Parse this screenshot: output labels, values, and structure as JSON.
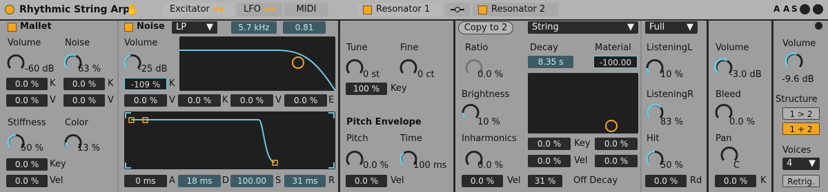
{
  "title_bar": {
    "device_name": "Rhythmic String Arp",
    "tabs": [
      {
        "label": "Excitator",
        "dots": 2
      },
      {
        "label": "LFO",
        "dots": 2
      },
      {
        "label": "MIDI",
        "dots": 0
      }
    ],
    "resonator_tabs": [
      {
        "label": "Resonator 1"
      },
      {
        "label": "Resonator 2"
      }
    ],
    "right_buttons": [
      "A",
      "A",
      "S"
    ]
  },
  "mallet": {
    "title": "Mallet",
    "volume": {
      "label": "Volume",
      "value": "-60 dB"
    },
    "noise": {
      "label": "Noise",
      "value": "63 %"
    },
    "row1": [
      {
        "value": "0.0 %",
        "suffix": "K"
      },
      {
        "value": "0.0 %",
        "suffix": "K"
      }
    ],
    "row2": [
      {
        "value": "0.0 %",
        "suffix": "V"
      },
      {
        "value": "0.0 %",
        "suffix": "V"
      }
    ],
    "stiffness": {
      "label": "Stiffness",
      "value": "50 %"
    },
    "color": {
      "label": "Color",
      "value": "13 %"
    },
    "key": {
      "value": "0.0 %",
      "suffix": "Key"
    },
    "vel": {
      "value": "0.0 %",
      "suffix": "Vel"
    }
  },
  "noise": {
    "title": "Noise",
    "filter_type": "LP",
    "freq": "5.7 kHz",
    "reso": "0.81",
    "volume": {
      "label": "Volume",
      "value": "-25 dB"
    },
    "vol_key": {
      "value": "-109 %",
      "suffix": "K"
    },
    "mod_row": [
      {
        "value": "0.0 %",
        "suffix": "V"
      },
      {
        "value": "0.0 %",
        "suffix": "K"
      },
      {
        "value": "0.0 %",
        "suffix": "V"
      },
      {
        "value": "0.0 %",
        "suffix": "E"
      }
    ],
    "env": [
      {
        "value": "0 ms",
        "suffix": "A"
      },
      {
        "value": "18 ms",
        "suffix": "D"
      },
      {
        "value": "100.00",
        "suffix": "S"
      },
      {
        "value": "31 ms",
        "suffix": "R"
      }
    ]
  },
  "tuning": {
    "tune": {
      "label": "Tune",
      "value": "0 st"
    },
    "fine": {
      "label": "Fine",
      "value": "0 ct"
    },
    "key": {
      "value": "100 %",
      "suffix": "Key"
    },
    "pitch_env_title": "Pitch Envelope",
    "pitch": {
      "label": "Pitch",
      "value": "0.0 %"
    },
    "time": {
      "label": "Time",
      "value": "100 ms"
    },
    "vel": {
      "value": "0.0 %",
      "suffix": "Vel"
    }
  },
  "resonator": {
    "copy_button": "Copy to 2",
    "type": "String",
    "quality": "Full",
    "ratio": {
      "label": "Ratio",
      "value": "0.0 %"
    },
    "decay": {
      "label": "Decay",
      "value": "8.35 s"
    },
    "material": {
      "label": "Material",
      "value": "-100.00"
    },
    "brightness": {
      "label": "Brightness",
      "value": "10 %"
    },
    "inharmonics": {
      "label": "Inharmonics",
      "value": "0.0 %"
    },
    "inh_vel": {
      "value": "0.0 %",
      "suffix": "Vel"
    },
    "decay_key": {
      "value": "0.0 %",
      "suffix": "Key"
    },
    "decay_key2": {
      "value": "0.0 %"
    },
    "decay_vel": {
      "value": "0.0 %",
      "suffix": "Vel"
    },
    "decay_vel2": {
      "value": "0.0 %"
    },
    "off_decay": {
      "value": "31 %",
      "suffix": "Off Decay"
    },
    "listening_l": {
      "label": "ListeningL",
      "value": "10 %"
    },
    "listening_r": {
      "label": "ListeningR",
      "value": "83 %"
    },
    "hit": {
      "label": "Hit",
      "value": "50 %"
    },
    "rd": {
      "value": "0.0 %",
      "suffix": "Rd"
    }
  },
  "output": {
    "volume": {
      "label": "Volume",
      "value": "-3.0 dB"
    },
    "bleed": {
      "label": "Bleed",
      "value": "0.0 %"
    },
    "pan": {
      "label": "Pan",
      "value": "C"
    },
    "k": {
      "value": "0.0 %",
      "suffix": "K"
    }
  },
  "global": {
    "volume": {
      "label": "Volume",
      "value": "-9.6 dB"
    },
    "structure_label": "Structure",
    "structure_options": [
      "1 > 2",
      "1 + 2"
    ],
    "voices_label": "Voices",
    "voices": "4",
    "retrig": "Retrig."
  },
  "colors": {
    "accent": "#f2a723",
    "knob_active": "#6ec8e0",
    "panel": "#9e9e9e",
    "field": "#2b2b2b"
  }
}
